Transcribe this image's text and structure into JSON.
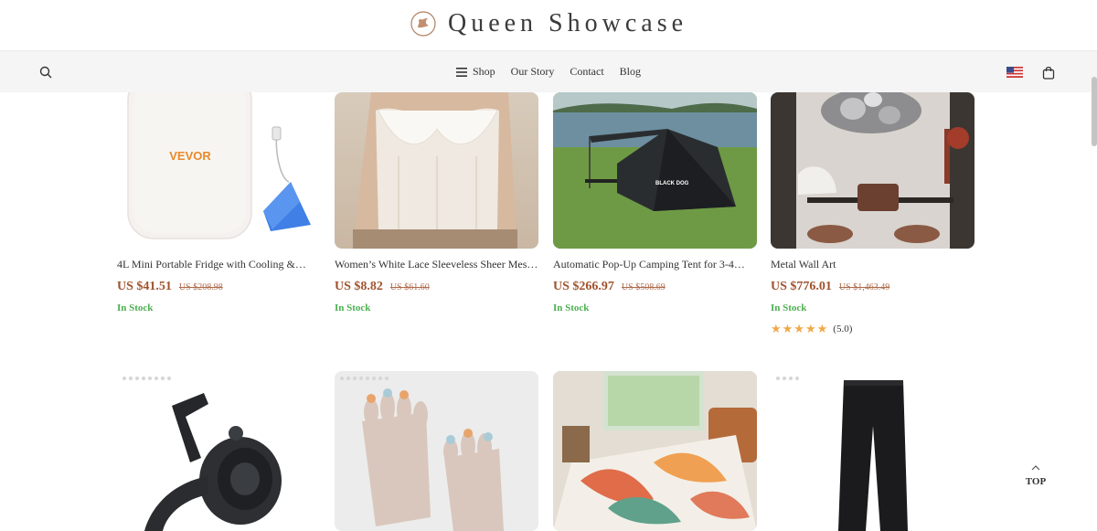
{
  "brand": {
    "name": "Queen Showcase"
  },
  "nav": {
    "items": [
      {
        "label": "Shop",
        "icon": "menu-icon"
      },
      {
        "label": "Our Story"
      },
      {
        "label": "Contact"
      },
      {
        "label": "Blog"
      }
    ],
    "search_icon": "search-icon",
    "flag_icon": "us-flag-icon",
    "cart_icon": "shopping-bag-icon"
  },
  "products": [
    {
      "title": "4L Mini Portable Fridge with Cooling &…",
      "price": "US $41.51",
      "old_price": "US $208.98",
      "stock": "In Stock"
    },
    {
      "title": "Women’s White Lace Sleeveless Sheer Mes…",
      "price": "US $8.82",
      "old_price": "US $61.60",
      "stock": "In Stock"
    },
    {
      "title": "Automatic Pop-Up Camping Tent for 3-4…",
      "price": "US $266.97",
      "old_price": "US $508.69",
      "stock": "In Stock"
    },
    {
      "title": "Metal Wall Art",
      "price": "US $776.01",
      "old_price": "US $1,463.49",
      "stock": "In Stock",
      "rating": 5.0,
      "rating_text": "(5.0)"
    }
  ],
  "fridge_brand": "VEVOR",
  "tent_brand": "BLACK DOG",
  "top_button": {
    "label": "TOP"
  },
  "colors": {
    "price": "#a0522d",
    "in_stock": "#4caf50",
    "star": "#f0a848",
    "navbar_bg": "#f5f5f5"
  }
}
